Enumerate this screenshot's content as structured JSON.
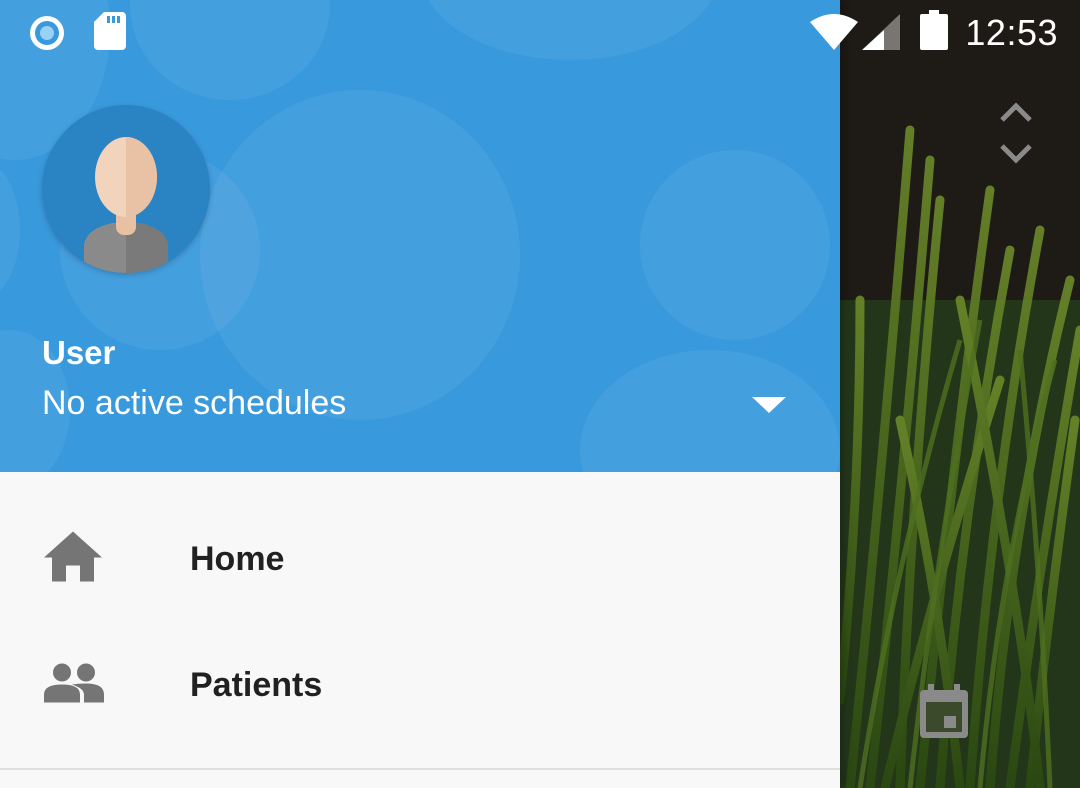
{
  "status_bar": {
    "time": "12:53",
    "icons": [
      "sync-circle-icon",
      "sd-card-icon",
      "wifi-icon",
      "signal-icon",
      "battery-icon"
    ]
  },
  "drawer": {
    "header": {
      "user_name": "User",
      "user_status": "No active schedules",
      "toggle_icon": "dropdown-arrow-icon",
      "background_color": "#3999dd"
    },
    "menu": [
      {
        "label": "Home",
        "icon": "home-icon"
      },
      {
        "label": "Patients",
        "icon": "people-icon"
      }
    ]
  },
  "background": {
    "icons": [
      "scroll-arrows-icon",
      "calendar-icon"
    ]
  }
}
